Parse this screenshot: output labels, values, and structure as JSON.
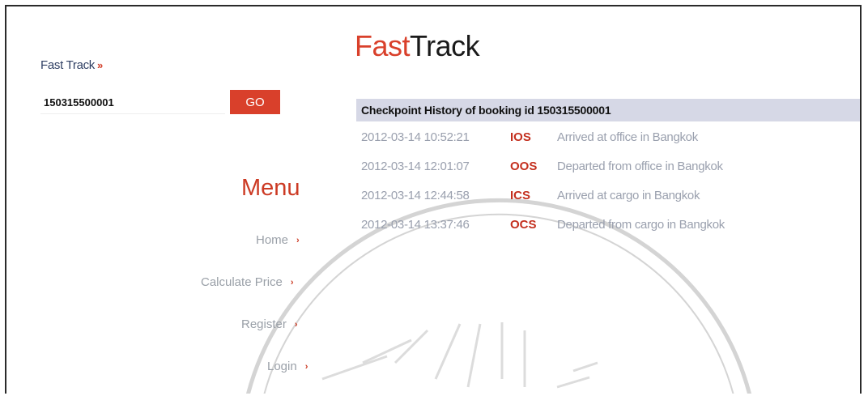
{
  "sidebar": {
    "fast_track_label": "Fast Track",
    "fast_track_marker": "»",
    "tracking_input_value": "150315500001",
    "go_label": "GO",
    "menu_title": "Menu",
    "menu_items": [
      {
        "label": "Home",
        "arrow": "›"
      },
      {
        "label": "Calculate Price",
        "arrow": "›"
      },
      {
        "label": "Register",
        "arrow": "›"
      },
      {
        "label": "Login",
        "arrow": "›"
      }
    ]
  },
  "brand": {
    "part1": "Fast",
    "part2": "Track"
  },
  "history": {
    "header": "Checkpoint History of booking id 150315500001",
    "rows": [
      {
        "timestamp": "2012-03-14 10:52:21",
        "code": "IOS",
        "description": "Arrived at office in Bangkok"
      },
      {
        "timestamp": "2012-03-14 12:01:07",
        "code": "OOS",
        "description": "Departed from office in Bangkok"
      },
      {
        "timestamp": "2012-03-14 12:44:58",
        "code": "ICS",
        "description": "Arrived at cargo in Bangkok"
      },
      {
        "timestamp": "2012-03-14 13:37:46",
        "code": "OCS",
        "description": "Departed from cargo in Bangkok"
      }
    ]
  },
  "colors": {
    "accent": "#d9402b",
    "code_red": "#c4301f",
    "header_bg": "#d6d8e6",
    "muted_text": "#9aa0ae"
  }
}
